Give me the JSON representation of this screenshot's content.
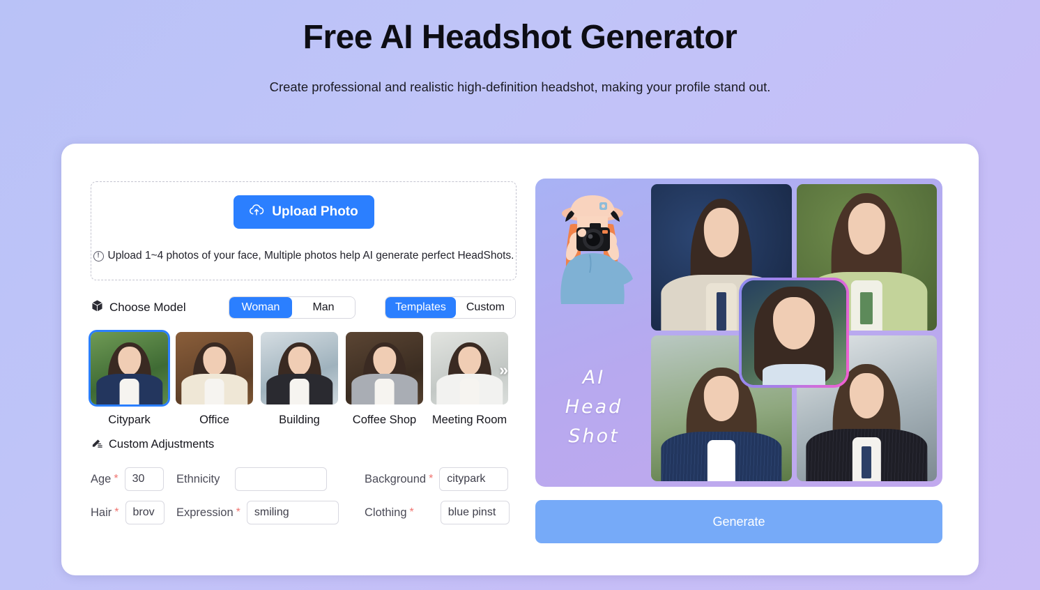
{
  "header": {
    "title": "Free AI Headshot Generator",
    "subtitle": "Create professional and realistic high-definition headshot, making your profile stand out."
  },
  "upload": {
    "button_label": "Upload Photo",
    "button_icon": "cloud-upload-icon",
    "hint_icon": "info-circle-icon",
    "hint": "Upload 1~4 photos of your face, Multiple photos help AI generate perfect HeadShots."
  },
  "model": {
    "icon": "cube-icon",
    "label": "Choose Model",
    "gender": {
      "options": [
        "Woman",
        "Man"
      ],
      "selected": "Woman"
    },
    "mode": {
      "options": [
        "Templates",
        "Custom"
      ],
      "selected": "Templates"
    }
  },
  "templates": {
    "next_icon": "double-chevron-right-icon",
    "selected": "Citypark",
    "items": [
      {
        "label": "Citypark",
        "bg": "#4c7a3f",
        "suit": "#23365e"
      },
      {
        "label": "Office",
        "bg": "#7b5434",
        "suit": "#efe7d6"
      },
      {
        "label": "Building",
        "bg": "#b9c6cf",
        "suit": "#2a2a30"
      },
      {
        "label": "Coffee Shop",
        "bg": "#4a392c",
        "suit": "#a9adb4"
      },
      {
        "label": "Meeting Room",
        "bg": "#d3d6d2",
        "suit": "#f2f2f0"
      }
    ]
  },
  "adjustments": {
    "icon": "edit-pen-icon",
    "title": "Custom Adjustments",
    "rows": [
      [
        {
          "label": "Age",
          "required": true,
          "value": "30",
          "placeholder": "",
          "size": "small"
        },
        {
          "label": "Ethnicity",
          "required": false,
          "value": "",
          "placeholder": "",
          "size": "wide"
        },
        {
          "label": "Background",
          "required": true,
          "value": "citypark",
          "placeholder": "",
          "size": "wide"
        }
      ],
      [
        {
          "label": "Hair",
          "required": true,
          "value": "brov",
          "placeholder": "",
          "size": "small"
        },
        {
          "label": "Expression",
          "required": true,
          "value": "smiling",
          "placeholder": "",
          "size": "wide"
        },
        {
          "label": "Clothing",
          "required": true,
          "value": "blue pinst",
          "placeholder": "",
          "size": "wide"
        }
      ]
    ]
  },
  "preview": {
    "art_caption_line1": "AI",
    "art_caption_line2": "Head",
    "art_caption_line3": "Shot",
    "illustration": "photographer-illustration",
    "tiles": [
      {
        "name": "navy-studio-headshot",
        "bg": "#1f3560",
        "suit": "#ddd6c8"
      },
      {
        "name": "green-studio-headshot",
        "bg": "#5c7a3e",
        "suit": "#c3d39a"
      },
      {
        "name": "outdoor-headshot",
        "bg": "#7f9a78",
        "suit": "#2a3f6b"
      },
      {
        "name": "office-headshot",
        "bg": "#9aa7ad",
        "suit": "#22222a"
      }
    ],
    "center_tile": {
      "name": "center-selected-portrait",
      "bg": "#21324f"
    }
  },
  "actions": {
    "generate_label": "Generate"
  },
  "colors": {
    "accent_blue": "#2b7fff",
    "generate_blue": "#76aaf8",
    "required_red": "#f0736f",
    "panel_gradient_start": "#a8b2f4",
    "panel_gradient_end": "#c1a9ee",
    "page_bg_start": "#b9c2f7",
    "page_bg_end": "#c9bdf6"
  }
}
